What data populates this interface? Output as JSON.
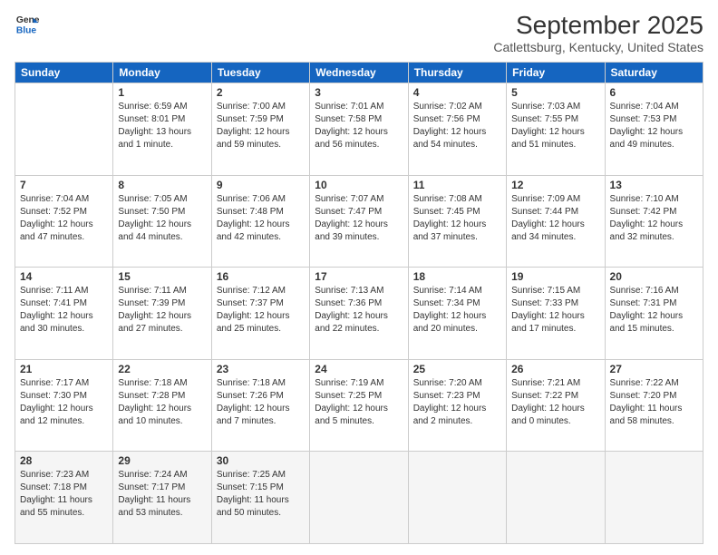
{
  "header": {
    "logo_line1": "General",
    "logo_line2": "Blue",
    "month": "September 2025",
    "location": "Catlettsburg, Kentucky, United States"
  },
  "days_of_week": [
    "Sunday",
    "Monday",
    "Tuesday",
    "Wednesday",
    "Thursday",
    "Friday",
    "Saturday"
  ],
  "weeks": [
    [
      {
        "day": "",
        "content": ""
      },
      {
        "day": "1",
        "content": "Sunrise: 6:59 AM\nSunset: 8:01 PM\nDaylight: 13 hours\nand 1 minute."
      },
      {
        "day": "2",
        "content": "Sunrise: 7:00 AM\nSunset: 7:59 PM\nDaylight: 12 hours\nand 59 minutes."
      },
      {
        "day": "3",
        "content": "Sunrise: 7:01 AM\nSunset: 7:58 PM\nDaylight: 12 hours\nand 56 minutes."
      },
      {
        "day": "4",
        "content": "Sunrise: 7:02 AM\nSunset: 7:56 PM\nDaylight: 12 hours\nand 54 minutes."
      },
      {
        "day": "5",
        "content": "Sunrise: 7:03 AM\nSunset: 7:55 PM\nDaylight: 12 hours\nand 51 minutes."
      },
      {
        "day": "6",
        "content": "Sunrise: 7:04 AM\nSunset: 7:53 PM\nDaylight: 12 hours\nand 49 minutes."
      }
    ],
    [
      {
        "day": "7",
        "content": "Sunrise: 7:04 AM\nSunset: 7:52 PM\nDaylight: 12 hours\nand 47 minutes."
      },
      {
        "day": "8",
        "content": "Sunrise: 7:05 AM\nSunset: 7:50 PM\nDaylight: 12 hours\nand 44 minutes."
      },
      {
        "day": "9",
        "content": "Sunrise: 7:06 AM\nSunset: 7:48 PM\nDaylight: 12 hours\nand 42 minutes."
      },
      {
        "day": "10",
        "content": "Sunrise: 7:07 AM\nSunset: 7:47 PM\nDaylight: 12 hours\nand 39 minutes."
      },
      {
        "day": "11",
        "content": "Sunrise: 7:08 AM\nSunset: 7:45 PM\nDaylight: 12 hours\nand 37 minutes."
      },
      {
        "day": "12",
        "content": "Sunrise: 7:09 AM\nSunset: 7:44 PM\nDaylight: 12 hours\nand 34 minutes."
      },
      {
        "day": "13",
        "content": "Sunrise: 7:10 AM\nSunset: 7:42 PM\nDaylight: 12 hours\nand 32 minutes."
      }
    ],
    [
      {
        "day": "14",
        "content": "Sunrise: 7:11 AM\nSunset: 7:41 PM\nDaylight: 12 hours\nand 30 minutes."
      },
      {
        "day": "15",
        "content": "Sunrise: 7:11 AM\nSunset: 7:39 PM\nDaylight: 12 hours\nand 27 minutes."
      },
      {
        "day": "16",
        "content": "Sunrise: 7:12 AM\nSunset: 7:37 PM\nDaylight: 12 hours\nand 25 minutes."
      },
      {
        "day": "17",
        "content": "Sunrise: 7:13 AM\nSunset: 7:36 PM\nDaylight: 12 hours\nand 22 minutes."
      },
      {
        "day": "18",
        "content": "Sunrise: 7:14 AM\nSunset: 7:34 PM\nDaylight: 12 hours\nand 20 minutes."
      },
      {
        "day": "19",
        "content": "Sunrise: 7:15 AM\nSunset: 7:33 PM\nDaylight: 12 hours\nand 17 minutes."
      },
      {
        "day": "20",
        "content": "Sunrise: 7:16 AM\nSunset: 7:31 PM\nDaylight: 12 hours\nand 15 minutes."
      }
    ],
    [
      {
        "day": "21",
        "content": "Sunrise: 7:17 AM\nSunset: 7:30 PM\nDaylight: 12 hours\nand 12 minutes."
      },
      {
        "day": "22",
        "content": "Sunrise: 7:18 AM\nSunset: 7:28 PM\nDaylight: 12 hours\nand 10 minutes."
      },
      {
        "day": "23",
        "content": "Sunrise: 7:18 AM\nSunset: 7:26 PM\nDaylight: 12 hours\nand 7 minutes."
      },
      {
        "day": "24",
        "content": "Sunrise: 7:19 AM\nSunset: 7:25 PM\nDaylight: 12 hours\nand 5 minutes."
      },
      {
        "day": "25",
        "content": "Sunrise: 7:20 AM\nSunset: 7:23 PM\nDaylight: 12 hours\nand 2 minutes."
      },
      {
        "day": "26",
        "content": "Sunrise: 7:21 AM\nSunset: 7:22 PM\nDaylight: 12 hours\nand 0 minutes."
      },
      {
        "day": "27",
        "content": "Sunrise: 7:22 AM\nSunset: 7:20 PM\nDaylight: 11 hours\nand 58 minutes."
      }
    ],
    [
      {
        "day": "28",
        "content": "Sunrise: 7:23 AM\nSunset: 7:18 PM\nDaylight: 11 hours\nand 55 minutes."
      },
      {
        "day": "29",
        "content": "Sunrise: 7:24 AM\nSunset: 7:17 PM\nDaylight: 11 hours\nand 53 minutes."
      },
      {
        "day": "30",
        "content": "Sunrise: 7:25 AM\nSunset: 7:15 PM\nDaylight: 11 hours\nand 50 minutes."
      },
      {
        "day": "",
        "content": ""
      },
      {
        "day": "",
        "content": ""
      },
      {
        "day": "",
        "content": ""
      },
      {
        "day": "",
        "content": ""
      }
    ]
  ]
}
